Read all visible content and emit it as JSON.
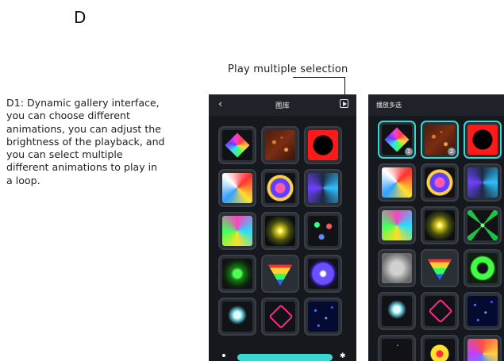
{
  "section_letter": "D",
  "description": "D1: Dynamic gallery interface, you can choose different animations, you can adjust the brightness of the playback, and you can select multiple different animations to play in a loop.",
  "callout_label": "Play multiple selection",
  "phone1": {
    "title": "图库",
    "back_icon": "chevron-left-icon",
    "play_icon": "play-multiple-icon",
    "tiles": [
      "a-diamond",
      "a-stars",
      "a-redhole",
      "a-stripes",
      "a-cube",
      "a-spiral",
      "a-tunnel",
      "a-yglow",
      "a-dots",
      "a-green",
      "a-prism",
      "a-blue",
      "a-flower",
      "a-pentagon",
      "a-bluestars"
    ],
    "brightness_icon": "sun-icon"
  },
  "phone2": {
    "title": "播放多选",
    "tiles": [
      {
        "art": "a-diamond",
        "selected": true,
        "badge": "1"
      },
      {
        "art": "a-stars",
        "selected": true,
        "badge": "2"
      },
      {
        "art": "a-redhole",
        "selected": true,
        "badge": ""
      },
      {
        "art": "a-stripes",
        "selected": false,
        "badge": ""
      },
      {
        "art": "a-cube",
        "selected": false,
        "badge": ""
      },
      {
        "art": "a-spiral",
        "selected": false,
        "badge": ""
      },
      {
        "art": "a-tunnel",
        "selected": false,
        "badge": ""
      },
      {
        "art": "a-yglow",
        "selected": false,
        "badge": ""
      },
      {
        "art": "a-cross",
        "selected": false,
        "badge": ""
      },
      {
        "art": "a-grey",
        "selected": false,
        "badge": ""
      },
      {
        "art": "a-prism",
        "selected": false,
        "badge": ""
      },
      {
        "art": "a-ring",
        "selected": false,
        "badge": ""
      },
      {
        "art": "a-flower",
        "selected": false,
        "badge": ""
      },
      {
        "art": "a-pentagon",
        "selected": false,
        "badge": ""
      },
      {
        "art": "a-bluestars",
        "selected": false,
        "badge": ""
      },
      {
        "art": "a-triangle",
        "selected": false,
        "badge": ""
      },
      {
        "art": "a-square",
        "selected": false,
        "badge": ""
      },
      {
        "art": "a-swirl",
        "selected": false,
        "badge": ""
      }
    ]
  },
  "colors": {
    "accent": "#3ad6d0",
    "phone_bg": "#15181d"
  }
}
